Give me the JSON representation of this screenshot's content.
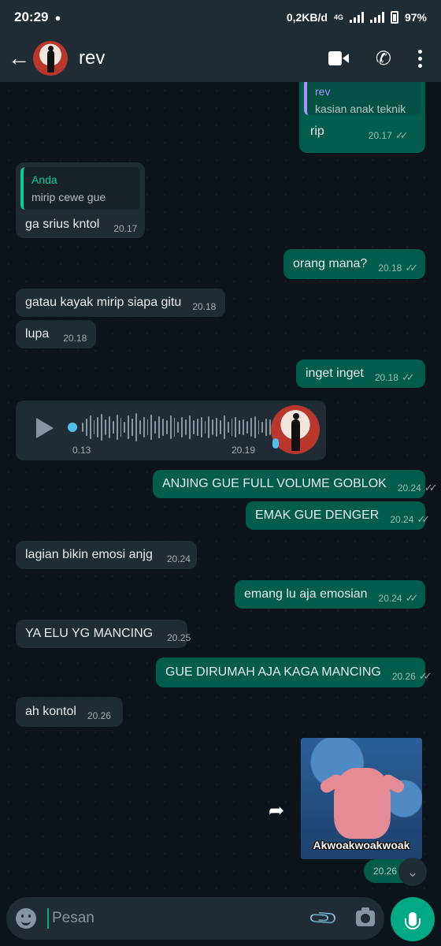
{
  "status_bar": {
    "time": "20:29",
    "net_speed": "0,2KB/d",
    "network": "4G",
    "battery": "97%"
  },
  "header": {
    "back_icon": "arrow-left-icon",
    "contact_name": "rev",
    "icons": [
      "video-call-icon",
      "voice-call-icon",
      "more-options-icon"
    ]
  },
  "messages": [
    {
      "dir": "out",
      "quote": {
        "name": "rev",
        "text": "kasian anak teknik"
      },
      "text": "rip",
      "time": "20.17",
      "read": true
    },
    {
      "dir": "in",
      "quote": {
        "name": "Anda",
        "text": "mirip cewe gue"
      },
      "text": "ga srius kntol",
      "time": "20.17"
    },
    {
      "dir": "out",
      "text": "orang mana?",
      "time": "20.18",
      "read": true
    },
    {
      "dir": "in",
      "text": "gatau kayak mirip siapa gitu",
      "time": "20.18"
    },
    {
      "dir": "in",
      "text": "lupa",
      "time": "20.18"
    },
    {
      "dir": "out",
      "text": "inget inget",
      "time": "20.18",
      "read": true
    },
    {
      "dir": "in",
      "type": "voice",
      "duration": "0.13",
      "time": "20.19"
    },
    {
      "dir": "out",
      "text": "ANJING GUE FULL VOLUME GOBLOK",
      "time": "20.24",
      "read": true
    },
    {
      "dir": "out",
      "text": "EMAK GUE DENGER",
      "time": "20.24",
      "read": true
    },
    {
      "dir": "in",
      "text": "lagian bikin emosi anjg",
      "time": "20.24"
    },
    {
      "dir": "out",
      "text": "emang lu aja emosian",
      "time": "20.24",
      "read": true
    },
    {
      "dir": "in",
      "text": "YA ELU YG MANCING",
      "time": "20.25"
    },
    {
      "dir": "out",
      "text": "GUE DIRUMAH AJA KAGA MANCING",
      "time": "20.26",
      "read": true
    },
    {
      "dir": "in",
      "text": "ah kontol",
      "time": "20.26"
    },
    {
      "dir": "out",
      "type": "sticker",
      "caption": "Akwoakwoakwoak",
      "time": "20.26"
    }
  ],
  "composer": {
    "placeholder": "Pesan",
    "icons": [
      "emoji-icon",
      "attach-icon",
      "camera-icon",
      "microphone-icon"
    ]
  },
  "colors": {
    "background": "#0b141a",
    "incoming_bubble": "#1f2c34",
    "outgoing_bubble": "#005c4b",
    "accent": "#00a884",
    "quote_rev": "#a791ff",
    "quote_anda": "#06cf9c"
  }
}
